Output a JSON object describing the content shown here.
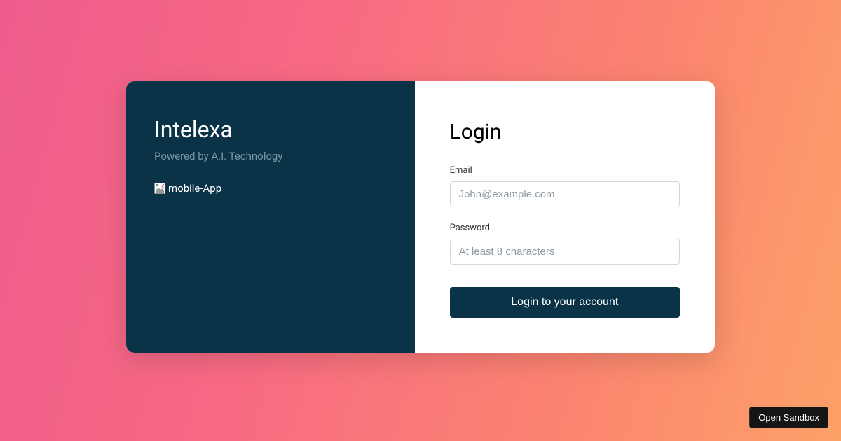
{
  "brand": {
    "title": "Intelexa",
    "subtitle": "Powered by A.I. Technology",
    "image_alt": "mobile-App"
  },
  "login": {
    "title": "Login",
    "email_label": "Email",
    "email_placeholder": "John@example.com",
    "password_label": "Password",
    "password_placeholder": "At least 8 characters",
    "button_label": "Login to your account"
  },
  "sandbox": {
    "button_label": "Open Sandbox"
  }
}
